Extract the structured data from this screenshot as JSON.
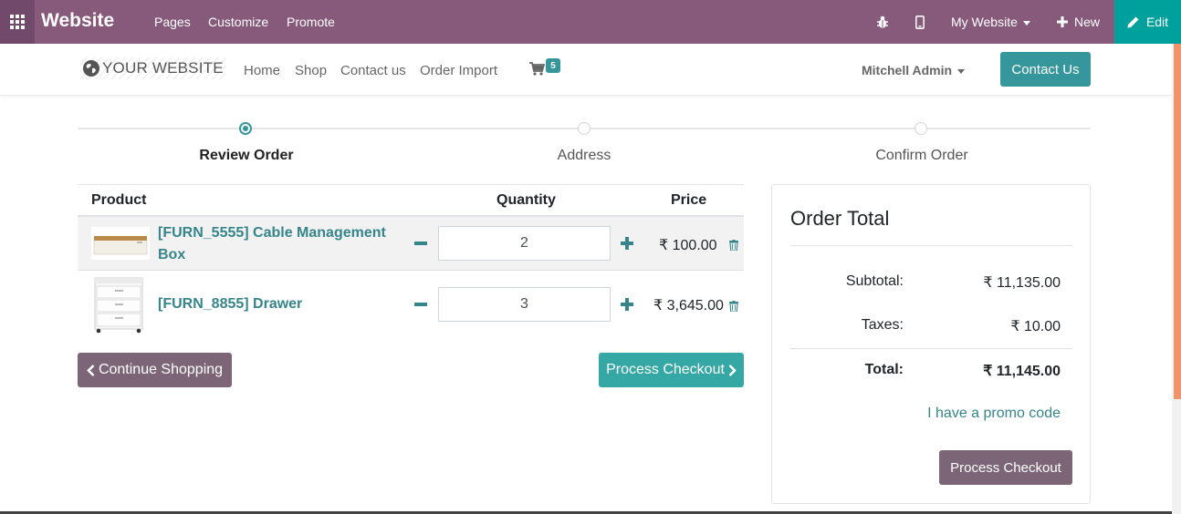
{
  "admin_bar": {
    "app_name": "Website",
    "menu": [
      "Pages",
      "Customize",
      "Promote"
    ],
    "website_selector": "My Website",
    "new_label": "New",
    "edit_label": "Edit",
    "icons": [
      "apps-grid-icon",
      "bug-icon",
      "mobile-icon",
      "plus-icon",
      "pencil-icon"
    ]
  },
  "site_header": {
    "logo_text": "YOUR WEBSITE",
    "nav": [
      "Home",
      "Shop",
      "Contact us",
      "Order Import"
    ],
    "cart_count": "5",
    "user_name": "Mitchell Admin",
    "contact_button": "Contact Us"
  },
  "wizard": {
    "steps": [
      "Review Order",
      "Address",
      "Confirm Order"
    ],
    "active_step": "Review Order"
  },
  "cart": {
    "headers": {
      "product": "Product",
      "quantity": "Quantity",
      "price": "Price"
    },
    "lines": [
      {
        "name": "[FURN_5555] Cable Management Box",
        "quantity": "2",
        "price": "₹ 100.00"
      },
      {
        "name": "[FURN_8855] Drawer",
        "quantity": "3",
        "price": "₹ 3,645.00"
      }
    ],
    "continue_label": "Continue Shopping",
    "checkout_label": "Process Checkout"
  },
  "order_total": {
    "title": "Order Total",
    "subtotal_label": "Subtotal:",
    "subtotal_value": "₹ 11,135.00",
    "taxes_label": "Taxes:",
    "taxes_value": "₹ 10.00",
    "total_label": "Total:",
    "total_value": "₹ 11,145.00",
    "promo_link": "I have a promo code",
    "checkout_label": "Process Checkout"
  },
  "colors": {
    "admin_bar": "#875a7b",
    "edit_button": "#00a09d",
    "primary": "#35979c",
    "secondary": "#7c6576",
    "link": "#35858a"
  }
}
